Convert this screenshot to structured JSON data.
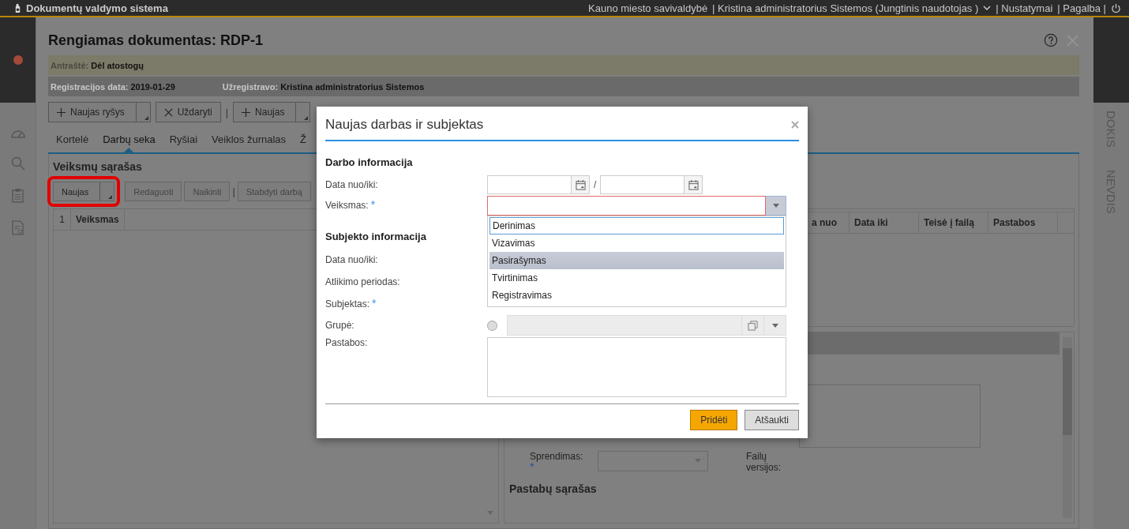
{
  "app_bar": {
    "title": "Dokumentų valdymo sistema",
    "org": "Kauno miesto savivaldybė",
    "user": "| Kristina administratorius Sistemos (Jungtinis naudotojas )",
    "links": [
      "| Nustatymai",
      "| Pagalba |"
    ]
  },
  "side_rail": {
    "labels": [
      "DOKIS",
      "NEVDIS"
    ]
  },
  "document": {
    "title": "Rengiamas dokumentas: RDP-1",
    "heading": {
      "label": "Antraštė:",
      "value": "Dėl atostogų"
    },
    "meta": [
      {
        "label": "Registracijos data:",
        "value": "2019-01-29"
      },
      {
        "label": "Užregistravo:",
        "value": "Kristina administratorius Sistemos"
      }
    ],
    "toolbar": [
      {
        "kind": "add_split",
        "label": "Naujas ryšys"
      },
      {
        "kind": "close",
        "label": "Uždaryti"
      },
      {
        "kind": "separator",
        "label": "|"
      },
      {
        "kind": "add_split",
        "label": "Naujas"
      }
    ],
    "tabs": [
      {
        "label": "Kortelė",
        "selected": false
      },
      {
        "label": "Darbų seka",
        "selected": true
      },
      {
        "label": "Ryšiai",
        "selected": false
      },
      {
        "label": "Veiklos žurnalas",
        "selected": false
      },
      {
        "label": "Ž",
        "selected": false
      }
    ],
    "actions": {
      "title": "Veiksmų sąrašas",
      "buttons": [
        {
          "kind": "split",
          "label": "Naujas",
          "highlighted": true
        },
        {
          "kind": "button",
          "label": "Redaguoti",
          "highlighted": false
        },
        {
          "kind": "button",
          "label": "Naikinti",
          "highlighted": false
        },
        {
          "kind": "separator",
          "label": "|"
        },
        {
          "kind": "button",
          "label": "Stabdyti darbą",
          "highlighted": false
        }
      ],
      "columns": [
        "1",
        "Veiksmas"
      ]
    },
    "detail": {
      "columns": [
        "a nuo",
        "Data iki",
        "Teisė į failą",
        "Pastabos"
      ],
      "decision_label": "Sprendimas:",
      "decision_required_mark": "*",
      "versions_label": "Failų versijos:",
      "notes_title": "Pastabų sąrašas"
    }
  },
  "dialog": {
    "title": "Naujas darbas ir subjektas",
    "sections": [
      {
        "title": "Darbo informacija",
        "rows": [
          {
            "label": "Data nuo/iki:",
            "kind": "date_range",
            "separator": "/"
          },
          {
            "label": "Veiksmas:",
            "required_mark": "*",
            "kind": "select",
            "invalid": true,
            "expanded": true,
            "options": [
              {
                "label": "Derinimas",
                "focused": true,
                "selected": false
              },
              {
                "label": "Vizavimas",
                "focused": false,
                "selected": false
              },
              {
                "label": "Pasirašymas",
                "focused": false,
                "selected": true
              },
              {
                "label": "Tvirtinimas",
                "focused": false,
                "selected": false
              },
              {
                "label": "Registravimas",
                "focused": false,
                "selected": false
              }
            ]
          }
        ]
      },
      {
        "title": "Subjekto informacija",
        "rows": [
          {
            "label": "Data nuo/iki:",
            "kind": "covered"
          },
          {
            "label": "Atlikimo periodas:",
            "kind": "covered"
          },
          {
            "label": "Subjektas:",
            "required_mark": "*",
            "kind": "covered"
          },
          {
            "label": "Grupė:",
            "kind": "group",
            "disabled": true,
            "checked": false
          },
          {
            "label": "Pastabos:",
            "kind": "textarea"
          }
        ]
      }
    ],
    "buttons": [
      {
        "label": "Pridėti",
        "primary": true
      },
      {
        "label": "Atšaukti",
        "primary": false
      }
    ]
  }
}
